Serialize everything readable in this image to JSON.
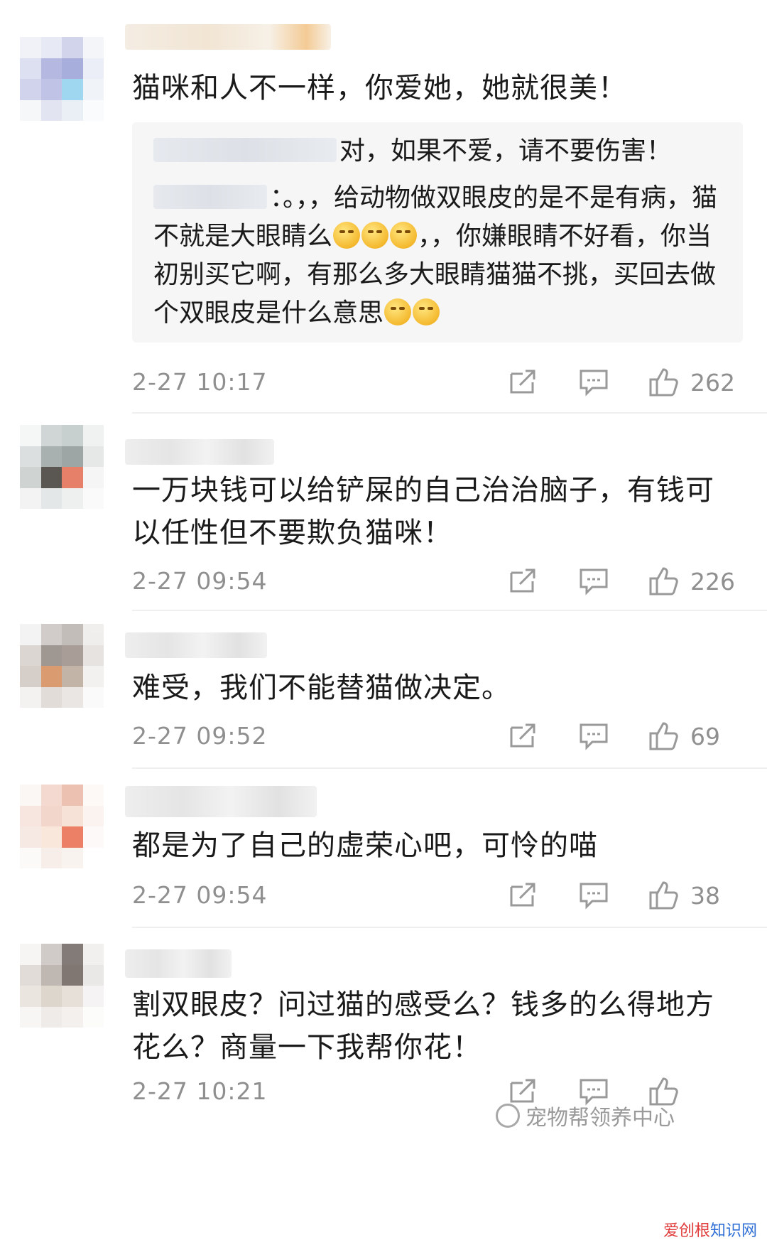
{
  "comments": [
    {
      "text": "猫咪和人不一样，你爱她，她就很美！",
      "replies": [
        {
          "text": "对，如果不爱，请不要伤害！"
        },
        {
          "text_before_emoji": "：。，，给动物做双眼皮的是不是有病，猫不就是大眼睛么",
          "text_after_emoji": "，，你嫌眼睛不好看，你当初别买它啊，有那么多大眼睛猫猫不挑，买回去做个双眼皮是什么意思"
        }
      ],
      "time": "2-27 10:17",
      "likes": "262"
    },
    {
      "text": "一万块钱可以给铲屎的自己治治脑子，有钱可以任性但不要欺负猫咪！",
      "time": "2-27 09:54",
      "likes": "226"
    },
    {
      "text": "难受，我们不能替猫做决定。",
      "time": "2-27 09:52",
      "likes": "69"
    },
    {
      "text": "都是为了自己的虚荣心吧，可怜的喵",
      "time": "2-27 09:54",
      "likes": "38"
    },
    {
      "text": "割双眼皮？问过猫的感受么？钱多的么得地方花么？商量一下我帮你花！",
      "time": "2-27 10:21",
      "likes": ""
    }
  ],
  "watermark": {
    "text": "宠物帮领养中心"
  },
  "brand": {
    "part1": "爱创根",
    "part2": "知识网"
  },
  "icons": {
    "share": "share-icon",
    "comment": "comment-icon",
    "like": "thumbs-up-icon"
  }
}
